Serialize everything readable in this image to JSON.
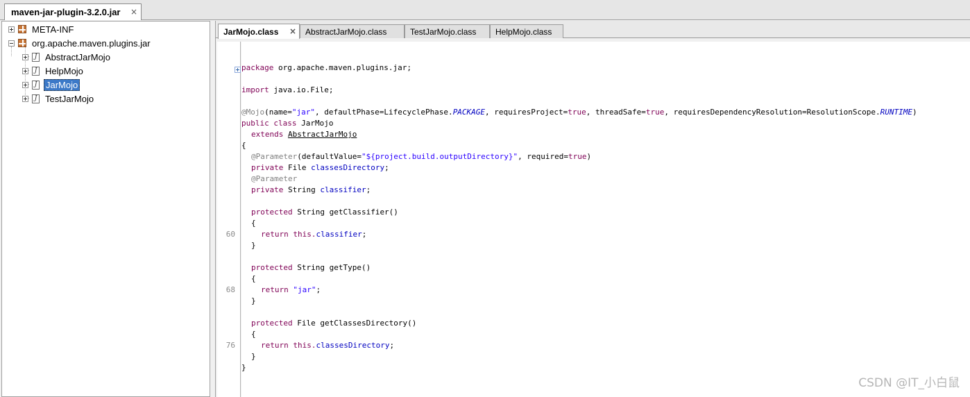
{
  "jar_tab": {
    "title": "maven-jar-plugin-3.2.0.jar",
    "close": "×"
  },
  "tree": {
    "items": [
      {
        "label": "META-INF",
        "kind": "package",
        "level": 0,
        "expander": "plus"
      },
      {
        "label": "org.apache.maven.plugins.jar",
        "kind": "package",
        "level": 0,
        "expander": "minus"
      },
      {
        "label": "AbstractJarMojo",
        "kind": "class",
        "level": 1,
        "expander": "plus"
      },
      {
        "label": "HelpMojo",
        "kind": "class",
        "level": 1,
        "expander": "plus"
      },
      {
        "label": "JarMojo",
        "kind": "class",
        "level": 1,
        "expander": "plus",
        "selected": true
      },
      {
        "label": "TestJarMojo",
        "kind": "class",
        "level": 1,
        "expander": "plus"
      }
    ]
  },
  "editor": {
    "tabs": [
      {
        "label": "JarMojo.class",
        "active": true
      },
      {
        "label": "AbstractJarMojo.class"
      },
      {
        "label": "TestJarMojo.class"
      },
      {
        "label": "HelpMojo.class"
      }
    ],
    "tab_close": "×",
    "line_numbers": {
      "l60": "60",
      "l68": "68",
      "l76": "76"
    },
    "code": {
      "package_kw": "package",
      "package_name": " org.apache.maven.plugins.jar;",
      "import_kw": "import",
      "import_name": " java.io.File;",
      "mojo_ann": "@Mojo",
      "mojo_a": "(name=",
      "mojo_name_val": "\"jar\"",
      "mojo_b": ", defaultPhase=LifecyclePhase.",
      "mojo_phase": "PACKAGE",
      "mojo_c": ", requiresProject=",
      "mojo_true1": "true",
      "mojo_d": ", threadSafe=",
      "mojo_true2": "true",
      "mojo_e": ", requiresDependencyResolution=ResolutionScope.",
      "mojo_scope": "RUNTIME",
      "mojo_f": ")",
      "class_kw": "public class",
      "class_name": " JarMojo",
      "extends_kw": "extends",
      "extends_name": "AbstractJarMojo",
      "open_brace": "{",
      "close_brace": "}",
      "param_ann": "@Parameter",
      "param_a": "(defaultValue=",
      "param_val": "\"${project.build.outputDirectory}\"",
      "param_b": ", required=",
      "param_true": "true",
      "param_c": ")",
      "private_kw": "private",
      "file_type": " File ",
      "classes_dir": "classesDirectory",
      "semi": ";",
      "string_type": " String ",
      "classifier": "classifier",
      "protected_kw": "protected",
      "get_classifier": " String getClassifier()",
      "return_kw": "return",
      "this_kw": " this.",
      "get_type": " String getType()",
      "jar_str": "\"jar\"",
      "get_classes_dir": " File getClassesDirectory()"
    }
  },
  "watermark": "CSDN @IT_小白鼠"
}
